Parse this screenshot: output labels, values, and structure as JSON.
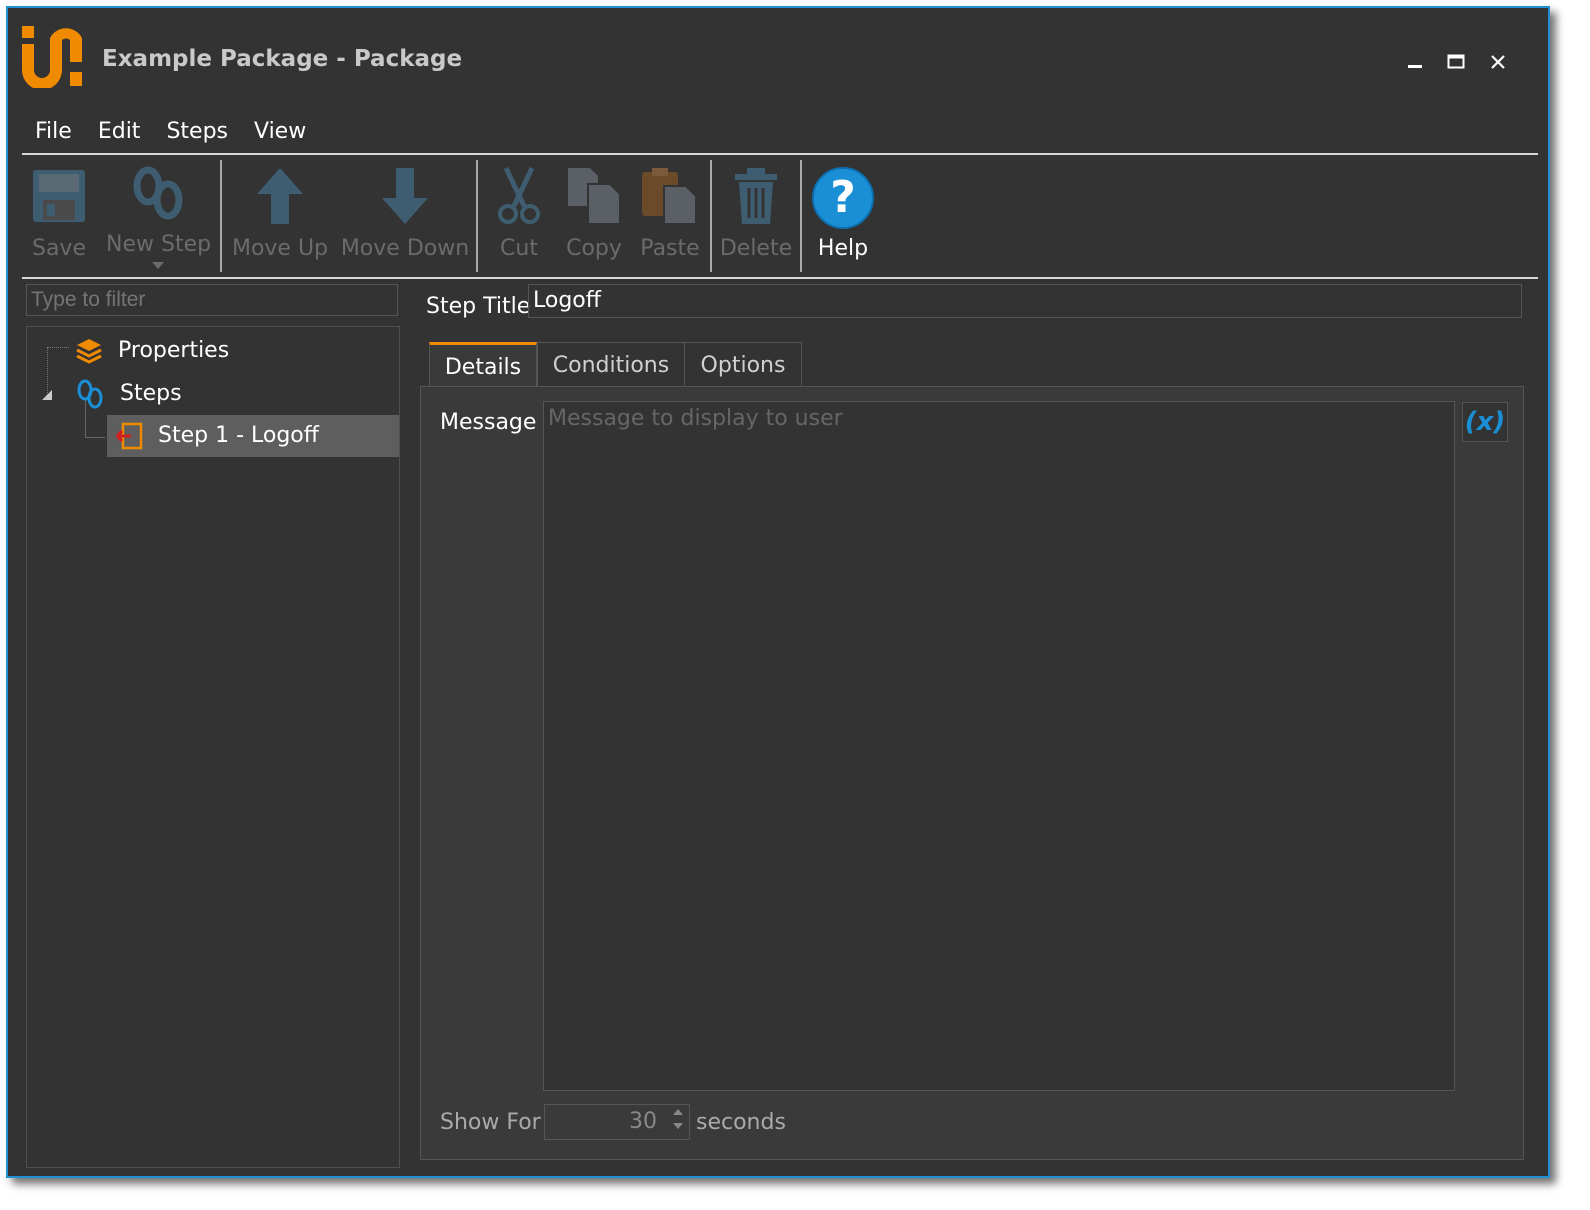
{
  "window": {
    "title": "Example Package - Package",
    "logo_label": "un logo",
    "controls": {
      "minimize": "minimize",
      "maximize": "maximize",
      "close": "close"
    }
  },
  "menu": {
    "items": [
      {
        "label": "File"
      },
      {
        "label": "Edit"
      },
      {
        "label": "Steps"
      },
      {
        "label": "View"
      }
    ]
  },
  "toolbar": {
    "save": "Save",
    "new_step": "New Step",
    "move_up": "Move Up",
    "move_down": "Move Down",
    "cut": "Cut",
    "copy": "Copy",
    "paste": "Paste",
    "delete": "Delete",
    "help": "Help"
  },
  "sidebar": {
    "filter_placeholder": "Type to filter",
    "tree": {
      "properties": "Properties",
      "steps": "Steps",
      "step1": "Step 1 - Logoff"
    }
  },
  "editor": {
    "step_title_label": "Step Title",
    "step_title_value": "Logoff",
    "tabs": [
      {
        "label": "Details"
      },
      {
        "label": "Conditions"
      },
      {
        "label": "Options"
      }
    ],
    "message_label": "Message",
    "message_placeholder": "Message to display to user",
    "variable_button": "(x)",
    "show_for_label": "Show For",
    "show_for_value": "30",
    "seconds_label": "seconds"
  },
  "colors": {
    "accent": "#f08a00",
    "blue": "#1a8fd6",
    "background": "#333333",
    "border": "#1f8fd6"
  }
}
